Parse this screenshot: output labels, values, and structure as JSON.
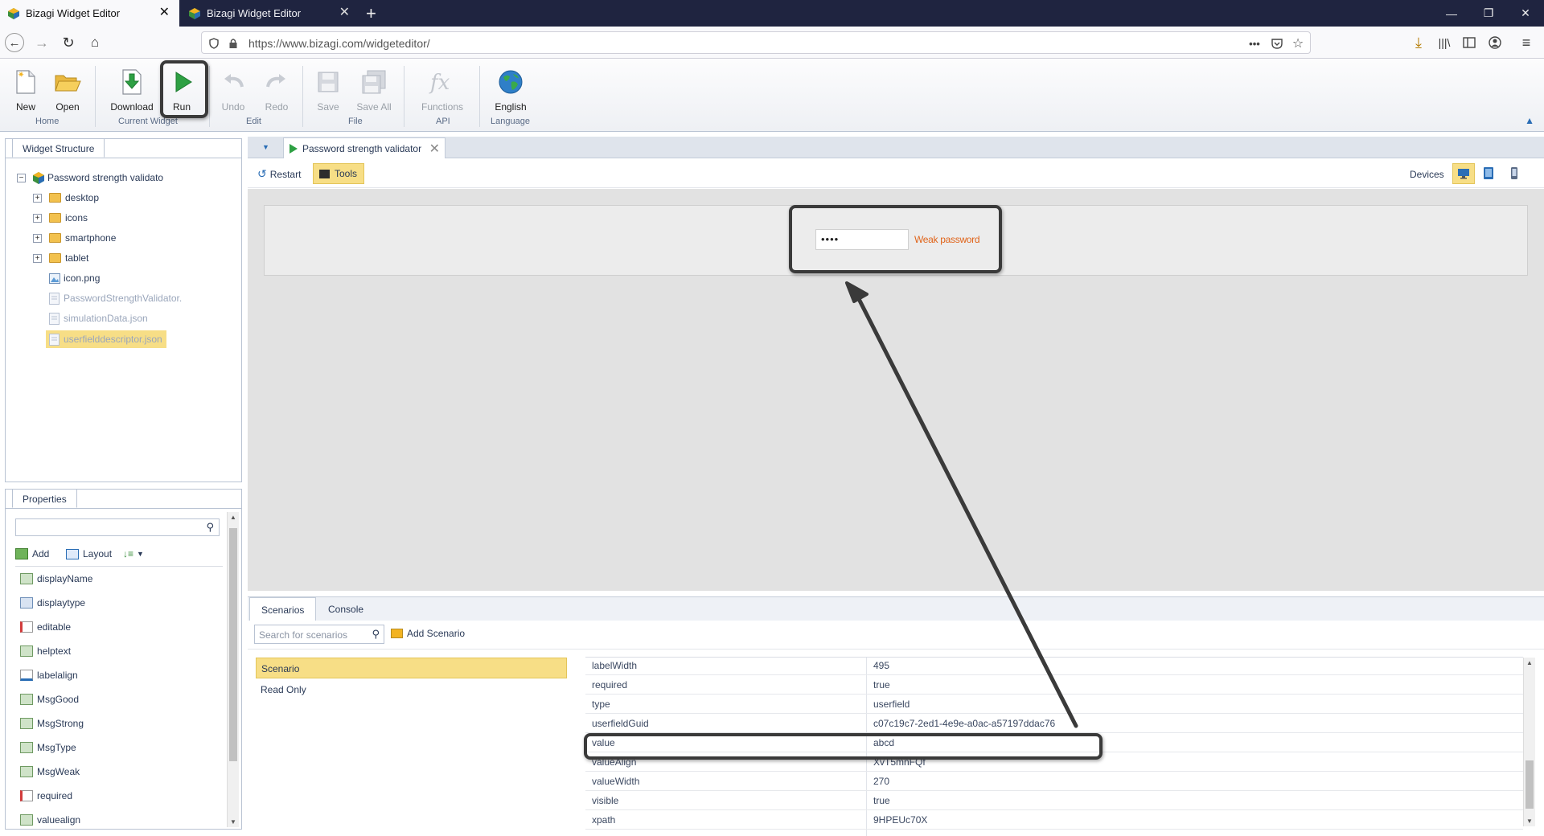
{
  "browser": {
    "tabs": [
      {
        "title": "Bizagi Widget Editor",
        "active": true
      },
      {
        "title": "Bizagi Widget Editor",
        "active": false
      }
    ],
    "new_tab_label": "+",
    "url": "https://www.bizagi.com/widgeteditor/"
  },
  "ribbon": {
    "buttons": {
      "new": "New",
      "open": "Open",
      "download": "Download",
      "run": "Run",
      "undo": "Undo",
      "redo": "Redo",
      "save": "Save",
      "save_all": "Save All",
      "functions": "Functions",
      "english": "English"
    },
    "groups": {
      "home": "Home",
      "current_widget": "Current Widget",
      "edit": "Edit",
      "file": "File",
      "api": "API",
      "language": "Language"
    }
  },
  "widget_structure": {
    "tab": "Widget Structure",
    "root": "Password strength validato",
    "folders": [
      "desktop",
      "icons",
      "smartphone",
      "tablet"
    ],
    "files": [
      "icon.png",
      "PasswordStrengthValidator.",
      "simulationData.json",
      "userfielddescriptor.json"
    ]
  },
  "properties": {
    "tab": "Properties",
    "add_label": "Add",
    "layout_label": "Layout",
    "items": [
      "displayName",
      "displaytype",
      "editable",
      "helptext",
      "labelalign",
      "MsgGood",
      "MsgStrong",
      "MsgType",
      "MsgWeak",
      "required",
      "valuealign"
    ]
  },
  "editor": {
    "doc_tab": "Password strength validator",
    "restart_label": "Restart",
    "tools_label": "Tools",
    "devices_label": "Devices",
    "preview": {
      "password_mask": "••••",
      "strength_message": "Weak password"
    }
  },
  "bottom": {
    "tabs": [
      "Scenarios",
      "Console"
    ],
    "search_placeholder": "Search for scenarios",
    "add_scenario_label": "Add Scenario",
    "scenarios": [
      "Scenario",
      "Read Only"
    ],
    "grid_rows": [
      {
        "key": "labelWidth",
        "value": "495"
      },
      {
        "key": "required",
        "value": "true"
      },
      {
        "key": "type",
        "value": "userfield"
      },
      {
        "key": "userfieldGuid",
        "value": "c07c19c7-2ed1-4e9e-a0ac-a57197ddac76"
      },
      {
        "key": "value",
        "value": "abcd"
      },
      {
        "key": "valueAlign",
        "value": "XvT5mnFQf"
      },
      {
        "key": "valueWidth",
        "value": "270"
      },
      {
        "key": "visible",
        "value": "true"
      },
      {
        "key": "xpath",
        "value": "9HPEUc70X"
      }
    ]
  },
  "colors": {
    "accent_green": "#2ea043",
    "warning_text": "#e0641a",
    "selection_yellow": "#f7de86",
    "annotation": "#3a3a3a"
  }
}
